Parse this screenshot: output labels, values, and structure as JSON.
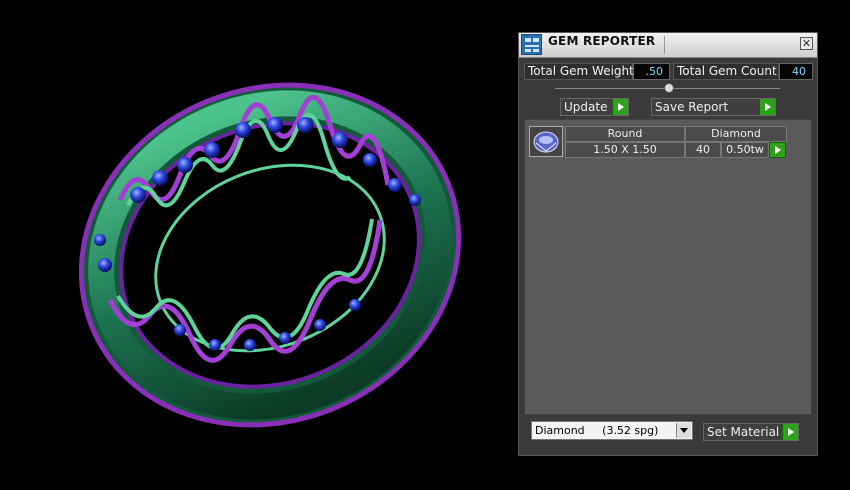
{
  "panel": {
    "title": "GEM REPORTER",
    "close_symbol": "✕",
    "total_gem_weight_label": "Total Gem Weight",
    "total_gem_weight_value": ".50",
    "total_gem_count_label": "Total Gem Count",
    "total_gem_count_value": "40",
    "update_label": "Update",
    "save_report_label": "Save Report",
    "gems": [
      {
        "shape": "Round",
        "material": "Diamond",
        "size": "1.50 X 1.50",
        "count": "40",
        "weight": "0.50tw"
      }
    ],
    "material_select_value": "Diamond     (3.52 spg)",
    "set_material_label": "Set Material"
  },
  "icons": {
    "app": "gem-reporter-app-icon",
    "close": "close-icon",
    "gem": "round-diamond-icon",
    "arrow": "green-arrow-icon",
    "dropdown": "chevron-down-icon"
  },
  "colors": {
    "ring_metal": "#1f7a55",
    "ring_edge": "#8a2fb8",
    "stones": "#2436c8",
    "accent_green": "#2fa11c",
    "value_text": "#7fd4ff"
  }
}
